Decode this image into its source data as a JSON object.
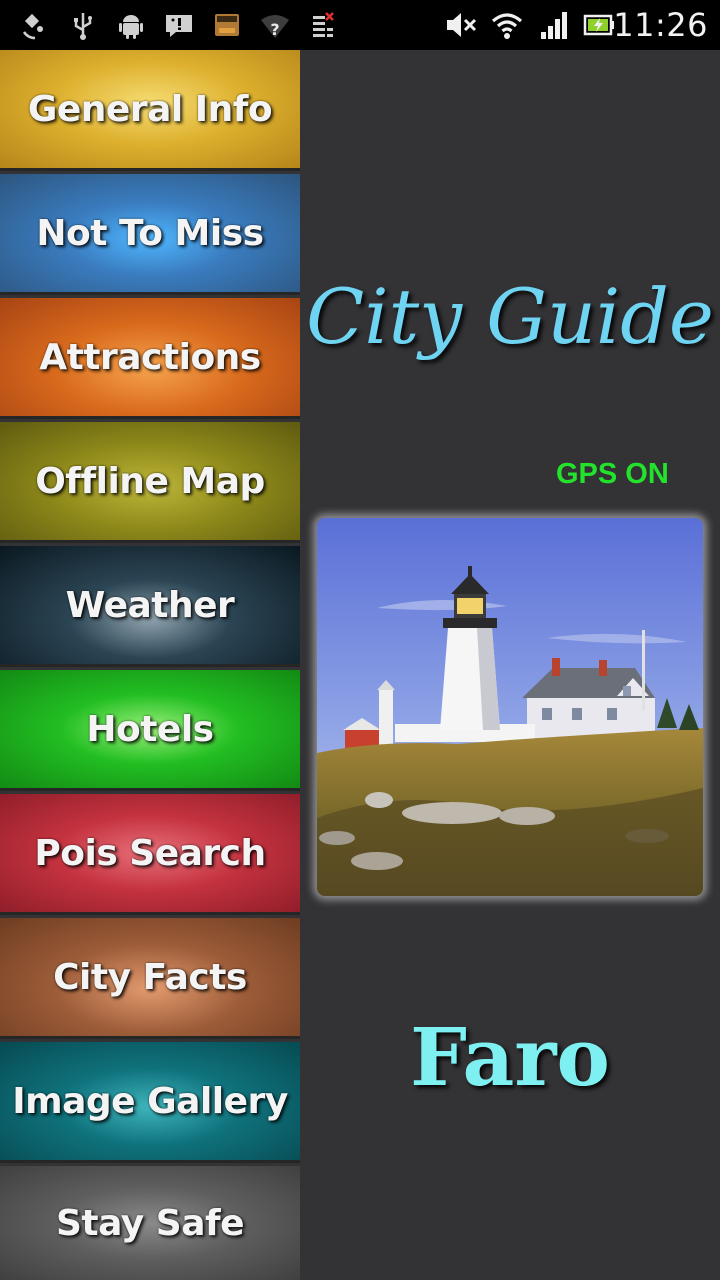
{
  "status_bar": {
    "time": "11:26",
    "icons": [
      "satellite-icon",
      "usb-icon",
      "android-icon",
      "chat-alert-icon",
      "amazon-appstore-icon",
      "wifi-unknown-icon",
      "tasks-icon",
      "mute-icon",
      "wifi-icon",
      "signal-icon",
      "battery-charging-icon"
    ]
  },
  "menu": {
    "items": [
      {
        "label": "General Info",
        "color": "#d9a92a"
      },
      {
        "label": "Not To Miss",
        "color": "#3d7fb8"
      },
      {
        "label": "Attractions",
        "color": "#d4621c"
      },
      {
        "label": "Offline Map",
        "color": "#8e8a18"
      },
      {
        "label": "Weather",
        "color": "#0f2430"
      },
      {
        "label": "Hotels",
        "color": "#1eb41e"
      },
      {
        "label": "Pois Search",
        "color": "#c1303e"
      },
      {
        "label": "City Facts",
        "color": "#9a5a36"
      },
      {
        "label": "Image Gallery",
        "color": "#0e6f78"
      },
      {
        "label": "Stay Safe",
        "color": "#5e5e5e"
      }
    ]
  },
  "main": {
    "title": "City Guide",
    "gps_status": "GPS ON",
    "city": "Faro",
    "title_color": "#6fd3f2",
    "city_color": "#7ff0f2",
    "gps_color": "#22e22b"
  }
}
